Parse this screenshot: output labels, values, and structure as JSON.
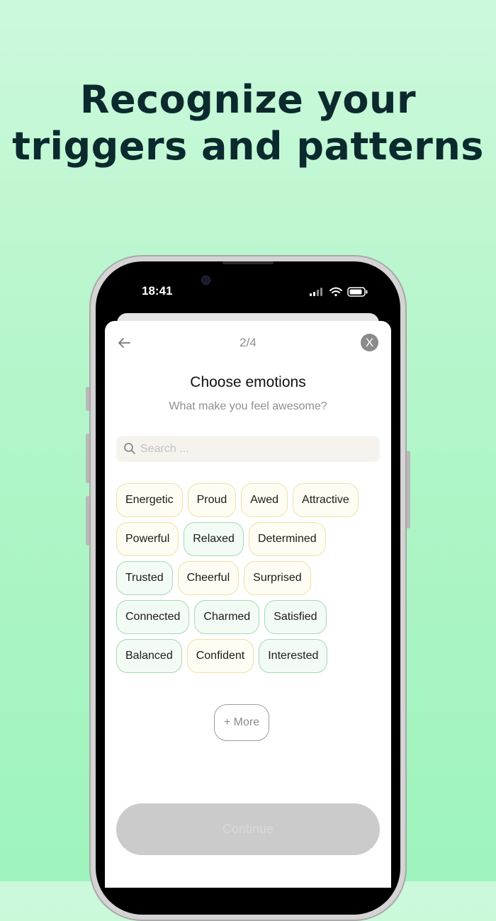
{
  "headline": {
    "line1": "Recognize your",
    "line2": "triggers and patterns"
  },
  "status_bar": {
    "time": "18:41",
    "icons": [
      "signal-icon",
      "wifi-icon",
      "battery-icon"
    ]
  },
  "header": {
    "step": "2/4",
    "close_label": "X"
  },
  "title": "Choose emotions",
  "subtitle": "What make you feel awesome?",
  "search": {
    "placeholder": "Search ..."
  },
  "chip_rows": [
    [
      {
        "label": "Energetic",
        "tone": "warm"
      },
      {
        "label": "Proud",
        "tone": "warm"
      },
      {
        "label": "Awed",
        "tone": "warm"
      },
      {
        "label": "Attractive",
        "tone": "warm"
      }
    ],
    [
      {
        "label": "Powerful",
        "tone": "warm"
      },
      {
        "label": "Relaxed",
        "tone": "cool"
      },
      {
        "label": "Determined",
        "tone": "warm"
      }
    ],
    [
      {
        "label": "Trusted",
        "tone": "cool"
      },
      {
        "label": "Cheerful",
        "tone": "warm"
      },
      {
        "label": "Surprised",
        "tone": "warm"
      }
    ],
    [
      {
        "label": "Connected",
        "tone": "cool"
      },
      {
        "label": "Charmed",
        "tone": "cool"
      },
      {
        "label": "Satisfied",
        "tone": "cool"
      }
    ],
    [
      {
        "label": "Balanced",
        "tone": "cool"
      },
      {
        "label": "Confident",
        "tone": "warm"
      },
      {
        "label": "Interested",
        "tone": "cool"
      }
    ]
  ],
  "more_label": "+ More",
  "continue_label": "Continue",
  "colors": {
    "headline": "#0b2a2e",
    "warm_chip_border": "#efdfa6",
    "cool_chip_border": "#a6d9b5",
    "continue_disabled": "#cbcbcb"
  }
}
